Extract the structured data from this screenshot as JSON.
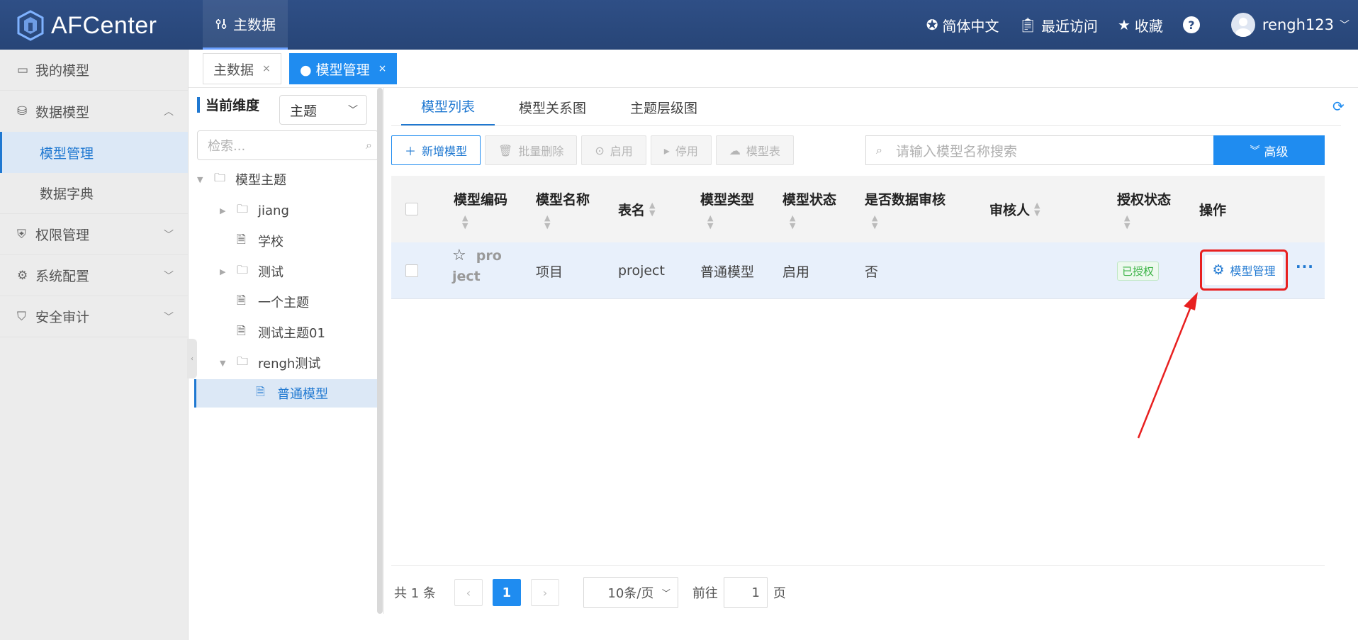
{
  "header": {
    "app_name": "AFCenter",
    "nav_item": "主数据",
    "language": "简体中文",
    "recent": "最近访问",
    "favorites": "收藏",
    "help": "?",
    "username": "rengh123"
  },
  "sidebar": {
    "items": [
      {
        "label": "我的模型"
      },
      {
        "label": "数据模型",
        "sub": [
          "模型管理",
          "数据字典"
        ]
      },
      {
        "label": "权限管理"
      },
      {
        "label": "系统配置"
      },
      {
        "label": "安全审计"
      }
    ]
  },
  "page_tabs": [
    {
      "label": "主数据",
      "close": "×"
    },
    {
      "label": "● 模型管理",
      "close": "×"
    }
  ],
  "tree": {
    "dimension_label": "当前维度",
    "dimension_value": "主题",
    "search_placeholder": "检索...",
    "nodes": [
      "模型主题",
      "jiang",
      "学校",
      "测试",
      "一个主题",
      "测试主题01",
      "rengh测试",
      "普通模型"
    ]
  },
  "main_tabs": [
    "模型列表",
    "模型关系图",
    "主题层级图"
  ],
  "toolbar": {
    "add": "新增模型",
    "batch_delete": "批量删除",
    "enable": "启用",
    "disable": "停用",
    "model_table": "模型表"
  },
  "search": {
    "placeholder": "请输入模型名称搜索",
    "advanced": "高级"
  },
  "table": {
    "headers": [
      "模型编码",
      "模型名称",
      "表名",
      "模型类型",
      "模型状态",
      "是否数据审核",
      "审核人",
      "授权状态",
      "操作"
    ],
    "row": {
      "code_line1": "pro",
      "code_line2": "ject",
      "name": "项目",
      "table_name": "project",
      "type": "普通模型",
      "status": "启用",
      "audit": "否",
      "auditor": "",
      "auth_status": "已授权",
      "op_label": "模型管理",
      "more": "···"
    }
  },
  "pagination": {
    "total": "共 1 条",
    "prev": "‹",
    "page": "1",
    "next": "›",
    "page_size": "10条/页",
    "goto_prefix": "前往",
    "goto_value": "1",
    "goto_suffix": "页"
  },
  "colors": {
    "header_bg": "#2f4f86",
    "accent": "#1f8cf0",
    "highlight": "#e82020",
    "success": "#3bb346"
  }
}
